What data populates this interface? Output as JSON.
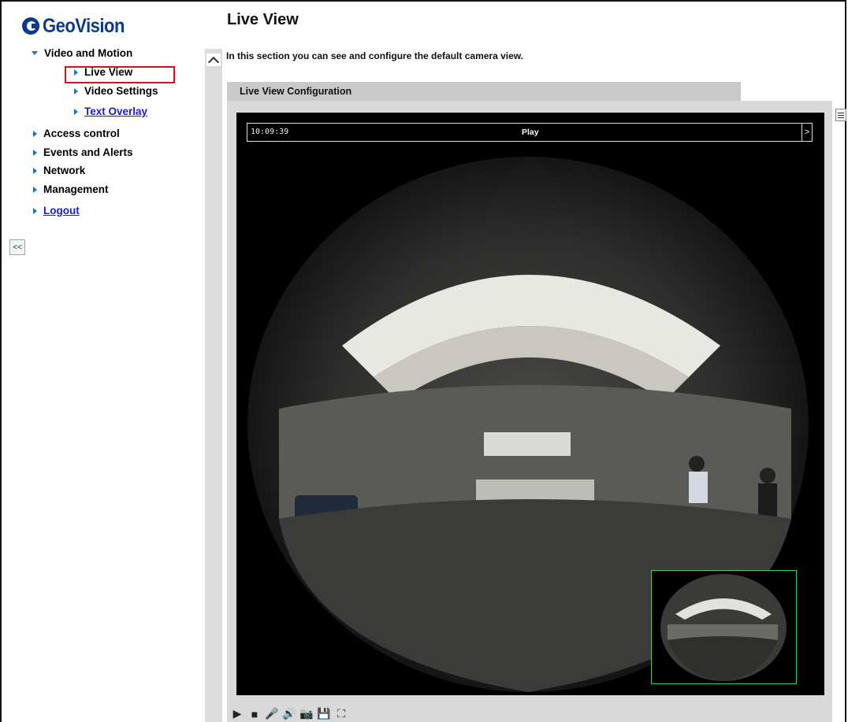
{
  "brand": {
    "logo_text": "GeoVision",
    "color": "#0b3a8c"
  },
  "nav": {
    "items": [
      {
        "label": "Video and Motion",
        "expanded": true
      },
      {
        "label": "Live View",
        "active": true
      },
      {
        "label": "Video Settings"
      },
      {
        "label": "Text Overlay",
        "link": true
      },
      {
        "label": "Access control"
      },
      {
        "label": "Events and Alerts"
      },
      {
        "label": "Network"
      },
      {
        "label": "Management"
      },
      {
        "label": "Logout",
        "link": true
      }
    ],
    "collapse_label": "<<"
  },
  "page": {
    "title": "Live View",
    "description": "In this section you can see and configure the default camera view.",
    "section_title": "Live View Configuration"
  },
  "video": {
    "time": "10:09:39",
    "play_label": "Play",
    "next_label": ">"
  },
  "toolbar": {
    "icons": [
      "play-icon",
      "stop-icon",
      "microphone-icon",
      "speaker-icon",
      "snapshot-icon",
      "record-icon",
      "fullscreen-icon"
    ],
    "glyphs": [
      "▶",
      "■",
      "🎤",
      "🔊",
      "📷",
      "💾",
      "⛶"
    ]
  },
  "colors": {
    "highlight": "#d4131c",
    "link": "#1a1adb",
    "pip_border": "#3ec86b"
  }
}
